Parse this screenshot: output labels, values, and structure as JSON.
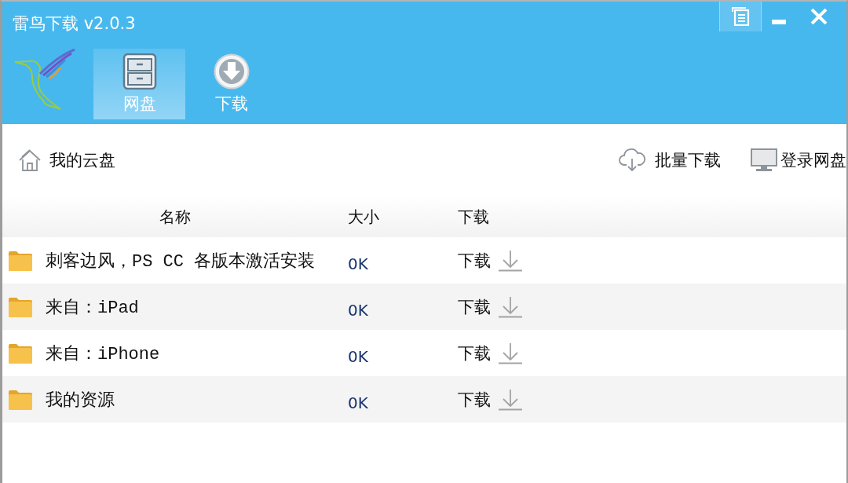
{
  "window": {
    "title": "雷鸟下载 v2.0.3",
    "controls": [
      {
        "kind": "menu",
        "highlighted": true
      },
      {
        "kind": "minimize",
        "highlighted": false
      },
      {
        "kind": "close",
        "highlighted": false
      }
    ]
  },
  "nav_tabs": [
    {
      "kind": "drive",
      "label": "网盘",
      "selected": true
    },
    {
      "kind": "download",
      "label": "下载",
      "selected": false
    }
  ],
  "toolbar": {
    "location": "我的云盘",
    "actions": [
      {
        "kind": "batch",
        "label": "批量下载"
      },
      {
        "kind": "login",
        "label": "登录网盘"
      }
    ]
  },
  "table": {
    "columns": [
      "名称",
      "大小",
      "下载"
    ],
    "rows": [
      {
        "name": "刺客边风，PS CC 各版本激活安装",
        "size": "0K",
        "action": "下载"
      },
      {
        "name": "来自：iPad",
        "size": "0K",
        "action": "下载"
      },
      {
        "name": "来自：iPhone",
        "size": "0K",
        "action": "下载"
      },
      {
        "name": "我的资源",
        "size": "0K",
        "action": "下载"
      }
    ]
  }
}
